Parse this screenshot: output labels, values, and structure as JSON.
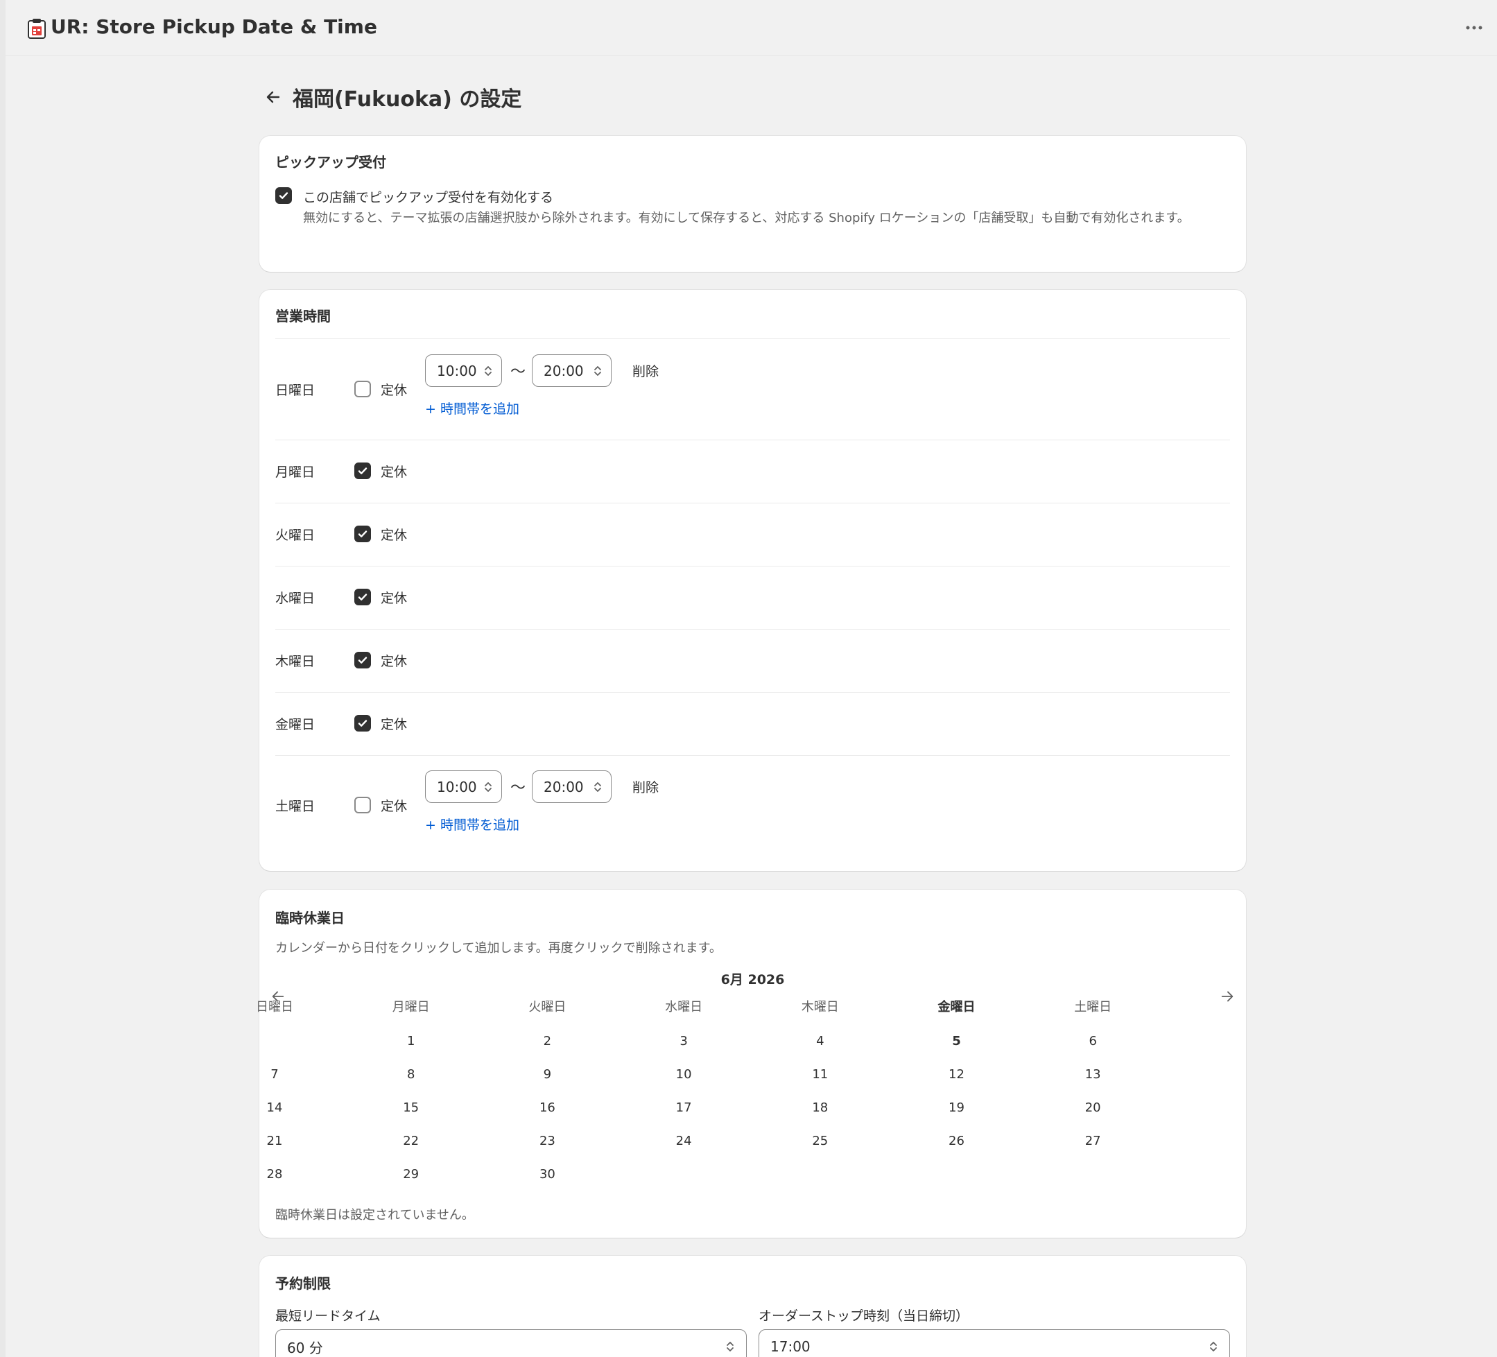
{
  "app": {
    "title": "UR: Store Pickup Date & Time"
  },
  "page": {
    "title": "福岡(Fukuoka) の設定"
  },
  "pickup": {
    "title": "ピックアップ受付",
    "enable_label": "この店舗でピックアップ受付を有効化する",
    "enabled": true,
    "help": "無効にすると、テーマ拡張の店舗選択肢から除外されます。有効にして保存すると、対応する Shopify ロケーションの「店舗受取」も自動で有効化されます。"
  },
  "hours": {
    "title": "営業時間",
    "closed_label": "定休",
    "delete_label": "削除",
    "add_label": "+ 時間帯を追加",
    "tilde": "〜",
    "days": [
      {
        "name": "日曜日",
        "closed": false,
        "start": "10:00",
        "end": "20:00"
      },
      {
        "name": "月曜日",
        "closed": true
      },
      {
        "name": "火曜日",
        "closed": true
      },
      {
        "name": "水曜日",
        "closed": true
      },
      {
        "name": "木曜日",
        "closed": true
      },
      {
        "name": "金曜日",
        "closed": true
      },
      {
        "name": "土曜日",
        "closed": false,
        "start": "10:00",
        "end": "20:00"
      }
    ]
  },
  "holidays": {
    "title": "臨時休業日",
    "help": "カレンダーから日付をクリックして追加します。再度クリックで削除されます。",
    "month_label": "6月 2026",
    "weekdays": [
      "日曜日",
      "月曜日",
      "火曜日",
      "水曜日",
      "木曜日",
      "金曜日",
      "土曜日"
    ],
    "today": 5,
    "first_weekday_index": 1,
    "days_in_month": 30,
    "empty_text": "臨時休業日は設定されていません。"
  },
  "limits": {
    "title": "予約制限",
    "lead_time_label": "最短リードタイム",
    "lead_time_value": "60 分",
    "order_stop_label": "オーダーストップ時刻（当日締切）",
    "order_stop_value": "17:00"
  }
}
